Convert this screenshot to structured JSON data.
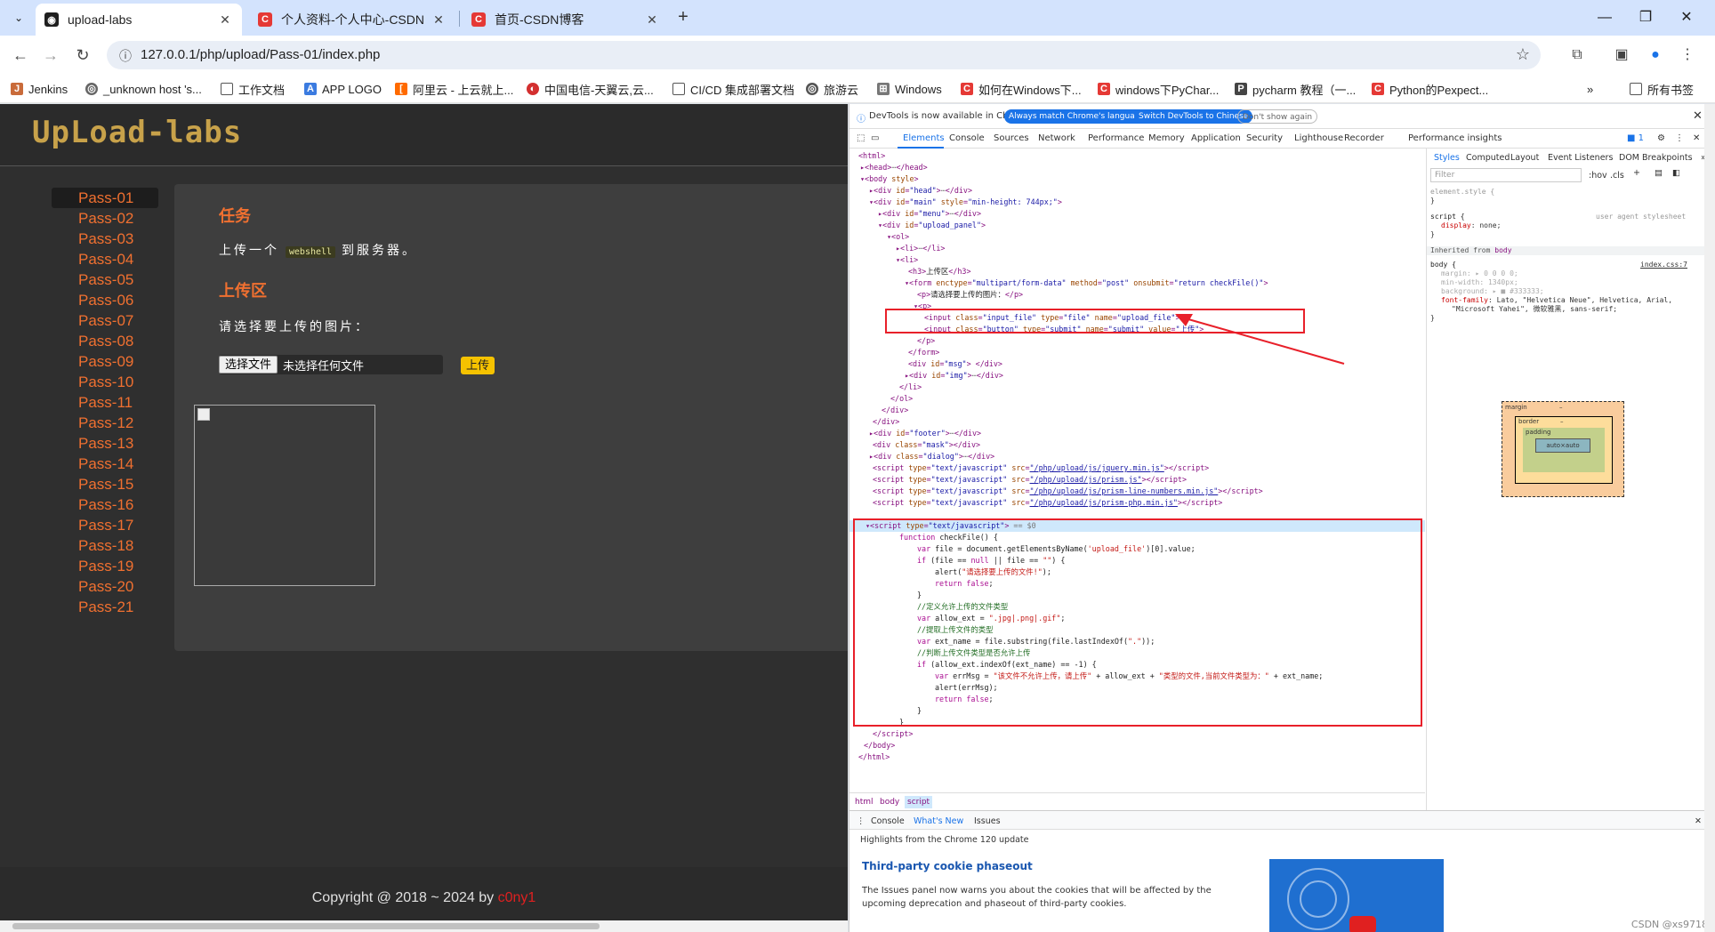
{
  "browser": {
    "tabs": [
      {
        "title": "upload-labs",
        "active": true,
        "favicon_color": "#1f1f1f"
      },
      {
        "title": "个人资料-个人中心-CSDN",
        "active": false,
        "favicon_color": "#e53935"
      },
      {
        "title": "首页-CSDN博客",
        "active": false,
        "favicon_color": "#e53935"
      }
    ],
    "url": "127.0.0.1/php/upload/Pass-01/index.php",
    "bookmarks": [
      "Jenkins",
      "_unknown host 's...",
      "工作文档",
      "APP LOGO",
      "阿里云 - 上云就上...",
      "中国电信-天翼云,云...",
      "CI/CD 集成部署文档",
      "旅游云",
      "Windows",
      "如何在Windows下...",
      "windows下PyChar...",
      "pycharm 教程（一...",
      "Python的Pexpect...",
      "所有书签"
    ]
  },
  "page": {
    "logo": "UpLoad-labs",
    "menu": [
      "Pass-01",
      "Pass-02",
      "Pass-03",
      "Pass-04",
      "Pass-05",
      "Pass-06",
      "Pass-07",
      "Pass-08",
      "Pass-09",
      "Pass-10",
      "Pass-11",
      "Pass-12",
      "Pass-13",
      "Pass-14",
      "Pass-15",
      "Pass-16",
      "Pass-17",
      "Pass-18",
      "Pass-19",
      "Pass-20",
      "Pass-21"
    ],
    "task_heading": "任务",
    "task_text_before": "上传一个",
    "task_code": "webshell",
    "task_text_after": "到服务器。",
    "upload_heading": "上传区",
    "upload_prompt": "请选择要上传的图片：",
    "file_button": "选择文件",
    "file_status": "未选择任何文件",
    "submit_label": "上传",
    "copyright": "Copyright @ 2018 ~ 2024 by ",
    "author": "c0ny1"
  },
  "devtools": {
    "info_text": "DevTools is now available in Chinese!",
    "btn_match": "Always match Chrome's language",
    "btn_switch": "Switch DevTools to Chinese",
    "btn_dont": "Don't show again",
    "tabs": [
      "Elements",
      "Console",
      "Sources",
      "Network",
      "Performance",
      "Memory",
      "Application",
      "Security",
      "Lighthouse",
      "Recorder",
      "Performance insights"
    ],
    "issues_badge": "1",
    "styles_tabs": [
      "Styles",
      "Computed",
      "Layout",
      "Event Listeners",
      "DOM Breakpoints"
    ],
    "filter_placeholder": "Filter",
    "hov": ":hov",
    "cls": ".cls",
    "breadcrumbs": [
      "html",
      "body",
      "script"
    ],
    "drawer_tabs": [
      "Console",
      "What's New",
      "Issues"
    ],
    "highlights": "Highlights from the Chrome 120 update",
    "whats_title": "Third-party cookie phaseout",
    "whats_body": "The Issues panel now warns you about the cookies that will be affected by the upcoming deprecation and phaseout of third-party cookies.",
    "watermark": "CSDN @xs9718"
  }
}
